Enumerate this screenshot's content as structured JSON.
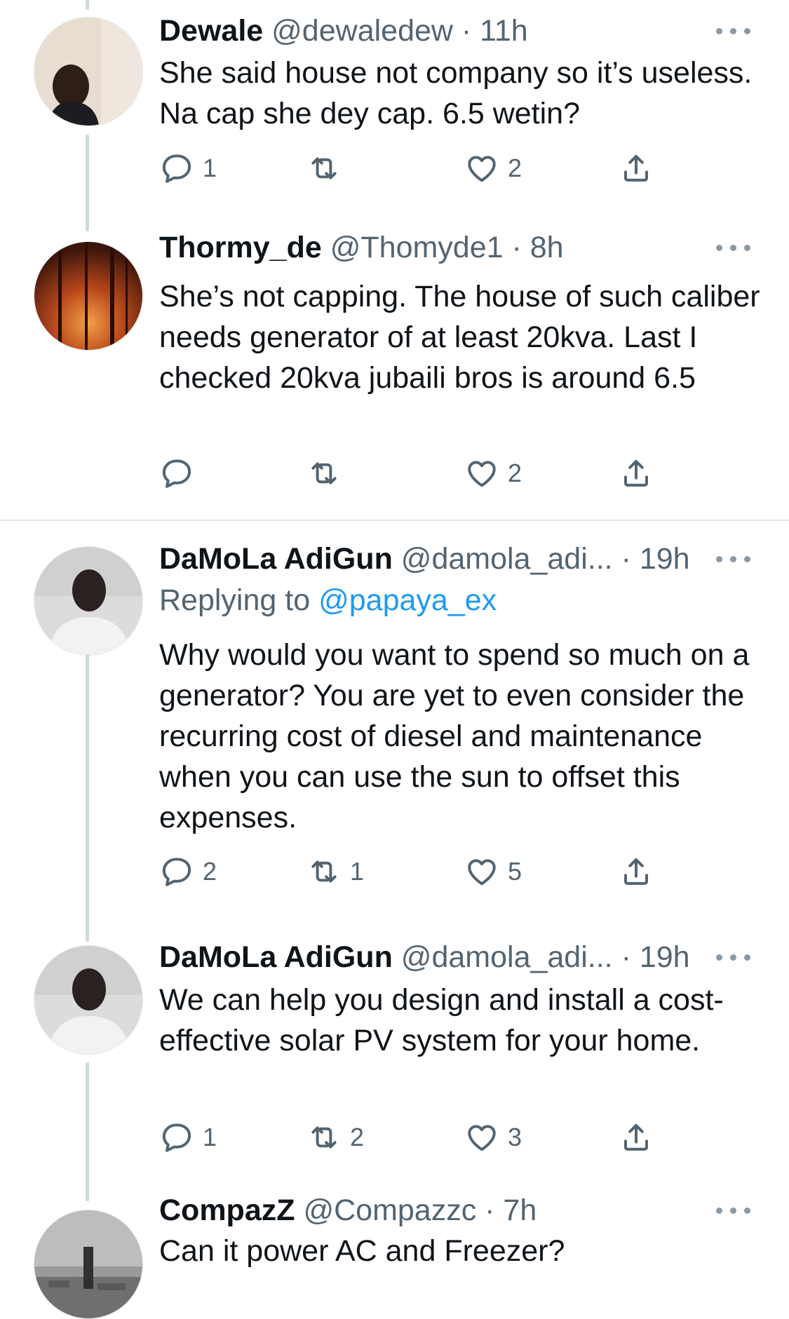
{
  "colors": {
    "text": "#0f1419",
    "secondary": "#536471",
    "link": "#1d9bf0",
    "thread_line": "#cfd9de"
  },
  "icons": [
    "reply-icon",
    "retweet-icon",
    "like-icon",
    "share-icon",
    "more-icon"
  ],
  "tweets": [
    {
      "name": "Dewale",
      "meta": "@dewaledew · 11h",
      "text": "She said house not company so it’s useless. Na cap she dey cap. 6.5 wetin?",
      "counts": {
        "replies": "1",
        "retweets": "",
        "likes": "2"
      }
    },
    {
      "name": "Thormy_de",
      "meta": "@Thomyde1 · 8h",
      "text": "She’s not capping. The house of such caliber needs generator of at least 20kva. Last I checked 20kva jubaili bros is around 6.5",
      "counts": {
        "replies": "",
        "retweets": "",
        "likes": "2"
      }
    },
    {
      "name": "DaMoLa AdiGun",
      "meta": "@damola_adi... · 19h",
      "replying_label": "Replying to",
      "replying_handle": "@papaya_ex",
      "text": "Why would you want to spend so much on a generator? You are yet to even consider the recurring cost of diesel and maintenance when you can use the sun to offset this expenses.",
      "counts": {
        "replies": "2",
        "retweets": "1",
        "likes": "5"
      }
    },
    {
      "name": "DaMoLa AdiGun",
      "meta": "@damola_adi... · 19h",
      "text": "We can help you design and install a cost-effective solar PV system for your home.",
      "counts": {
        "replies": "1",
        "retweets": "2",
        "likes": "3"
      }
    },
    {
      "name": "CompazZ",
      "meta": "@Compazzc · 7h",
      "text": "Can it power AC and Freezer?"
    }
  ]
}
